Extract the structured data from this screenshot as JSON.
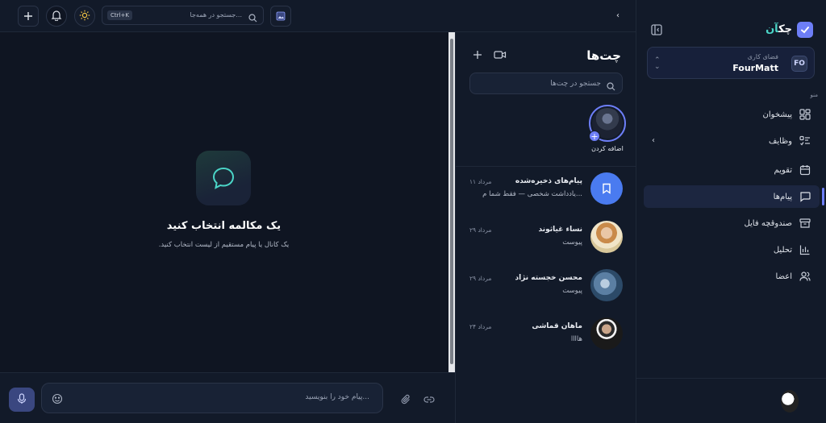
{
  "app": {
    "logo_prefix": "چک",
    "logo_accent": "آن"
  },
  "workspace": {
    "label": "فضای کاری",
    "name": "FourMatt",
    "badge": "FO"
  },
  "menu": {
    "title": "منو",
    "items": [
      {
        "label": "پیشخوان",
        "icon": "dashboard-icon"
      },
      {
        "label": "وظایف",
        "icon": "tasks-icon",
        "has_chevron": true
      },
      {
        "label": "تقویم",
        "icon": "calendar-icon"
      },
      {
        "label": "پیام‌ها",
        "icon": "message-icon",
        "active": true
      },
      {
        "label": "صندوقچه فایل",
        "icon": "archive-icon"
      },
      {
        "label": "تحلیل",
        "icon": "chart-icon"
      },
      {
        "label": "اعضا",
        "icon": "members-icon"
      }
    ]
  },
  "topbar": {
    "search_placeholder": "جستجو در همه‌جا...",
    "shortcut": "Ctrl+K",
    "rtl_mark": "‹"
  },
  "chats": {
    "title": "چت‌ها",
    "search_placeholder": "جستجو در چت‌ها",
    "story_label": "اضافه کردن",
    "conversations": [
      {
        "name": "پیام‌های ذخیره‌شده",
        "message": "یادداشت شخصی — فقط شما م...",
        "date": "۱۱ مرداد",
        "avatar": "saved"
      },
      {
        "name": "نساء غیاثوند",
        "message": "پیوست",
        "date": "۲۹ مرداد",
        "avatar": "person1"
      },
      {
        "name": "محسن خجسته نژاد",
        "message": "پیوست",
        "date": "۲۹ مرداد",
        "avatar": "person2"
      },
      {
        "name": "ماهان قماشی",
        "message": "هاااا",
        "date": "۲۴ مرداد",
        "avatar": "person3"
      }
    ]
  },
  "empty_state": {
    "title": "یک مکالمه انتخاب کنید",
    "subtitle": ".یک کانال یا پیام مستقیم از لیست انتخاب کنید"
  },
  "composer": {
    "placeholder": "پیام خود را بنویسید..."
  },
  "colors": {
    "accent": "#6d7ef7",
    "teal": "#4bd5c7",
    "bg": "#0f1522",
    "panel": "#121a29"
  }
}
